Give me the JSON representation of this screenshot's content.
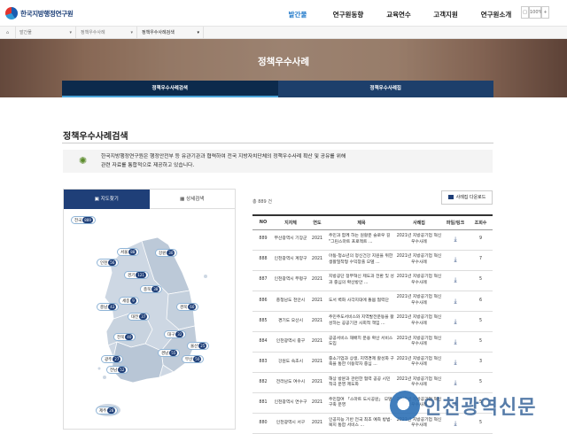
{
  "header": {
    "logo_text": "한국지방행정연구원",
    "nav": [
      "발간물",
      "연구원동향",
      "교육연수",
      "고객지원",
      "연구원소개"
    ],
    "active_nav": 0,
    "sitemap_label": "□",
    "zoom_label": "100%",
    "zoom_plus": "+"
  },
  "breadcrumb": {
    "items": [
      "발간물",
      "정책우수사례",
      "정책우수사례검색"
    ]
  },
  "banner": {
    "title": "정책우수사례",
    "tabs": [
      "정책우수사례검색",
      "정책우수사례집"
    ],
    "active_tab": 0
  },
  "section": {
    "title": "정책우수사례검색",
    "intro_line1": "한국지방행정연구원은 행정안전부 등 유관기관과 협력하여 전국 지방자치단체의 정책우수사례 확산 및 공유를 위해",
    "intro_line2": "관련 자료를 통합적으로 제공하고 있습니다."
  },
  "map_panel": {
    "tab_map": "지도찾기",
    "tab_detail": "상세검색",
    "regions": [
      {
        "name": "전국",
        "count": "889"
      },
      {
        "name": "서울",
        "count": "88"
      },
      {
        "name": "강원",
        "count": "30"
      },
      {
        "name": "인천",
        "count": "56"
      },
      {
        "name": "경기",
        "count": "121"
      },
      {
        "name": "충북",
        "count": "38"
      },
      {
        "name": "세종",
        "count": "9"
      },
      {
        "name": "충남",
        "count": "43"
      },
      {
        "name": "대전",
        "count": "37"
      },
      {
        "name": "경북",
        "count": "60"
      },
      {
        "name": "전북",
        "count": "40"
      },
      {
        "name": "대구",
        "count": "32"
      },
      {
        "name": "울산",
        "count": "25"
      },
      {
        "name": "경남",
        "count": "55"
      },
      {
        "name": "부산",
        "count": "50"
      },
      {
        "name": "광주",
        "count": "27"
      },
      {
        "name": "전남",
        "count": "52"
      },
      {
        "name": "제주",
        "count": "28"
      }
    ]
  },
  "results": {
    "total_label": "총 889 건",
    "download_label": "사례집 다운로드",
    "columns": [
      "NO",
      "지자체",
      "연도",
      "제목",
      "사례집",
      "파일/링크",
      "조회수"
    ],
    "rows": [
      {
        "no": "889",
        "region": "부산광역시 기장군",
        "year": "2021",
        "title": "주민과 함께 하는 원활운 슬로우 길 \"그린스마트 프로젝트 ...",
        "book": "2021년 지방공기업 혁신우수사례",
        "views": "9"
      },
      {
        "no": "888",
        "region": "인천광역시 계양구",
        "year": "2021",
        "title": "아동·청소년의 정신건강 지원을 위한 생활밀착형 수익창출 모델 ...",
        "book": "2021년 지방공기업 혁신우수사례",
        "views": "7"
      },
      {
        "no": "887",
        "region": "인천광역시 부평구",
        "year": "2021",
        "title": "지방공단 정부혁신 제도과 전환 및 성과 중심의 확산방안 ...",
        "book": "2021년 지방공기업 혁신우수사례",
        "views": "5"
      },
      {
        "no": "886",
        "region": "충청남도 천안시",
        "year": "2021",
        "title": "도서 벽화 사각지대에 돌봄 협력단",
        "book": "2021년 지방공기업 혁신우수사례",
        "views": "6"
      },
      {
        "no": "885",
        "region": "경기도 오산시",
        "year": "2021",
        "title": "주민주도서비스와 지역발전운동을 활성하는 공공기관 사회적 책임 ...",
        "book": "2021년 지방공기업 혁신우수사례",
        "views": "5"
      },
      {
        "no": "884",
        "region": "인천광역시 중구",
        "year": "2021",
        "title": "공공서비스 재배치 운용 확산 서비스 도입",
        "book": "2021년 지방공기업 혁신우수사례",
        "views": "5"
      },
      {
        "no": "883",
        "region": "강원도 속초시",
        "year": "2021",
        "title": "중소기업과 상생, 지역경제 활성화 구축을 통한 이동약자 중심 ...",
        "book": "2021년 지방공기업 혁신우수사례",
        "views": "3"
      },
      {
        "no": "882",
        "region": "전라남도 여수시",
        "year": "2021",
        "title": "해상 방문과 관련한 협력 공공 시민 적극 운영 제도화",
        "book": "2021년 지방공기업 혁신우수사례",
        "views": "5"
      },
      {
        "no": "881",
        "region": "인천광역시 연수구",
        "year": "2021",
        "title": "주민참여 「스마트 도시공원」 모델 구축 운영",
        "book": "2021년 지방공기업 혁신우수사례",
        "views": "5"
      },
      {
        "no": "880",
        "region": "인천광역시 서구",
        "year": "2021",
        "title": "인공지능 기반 전국 최초 예측 방범·복지 통합 서비스 ...",
        "book": "2021년 지방공기업 혁신우수사례",
        "views": "5"
      }
    ]
  },
  "watermark": "인천광역신문"
}
